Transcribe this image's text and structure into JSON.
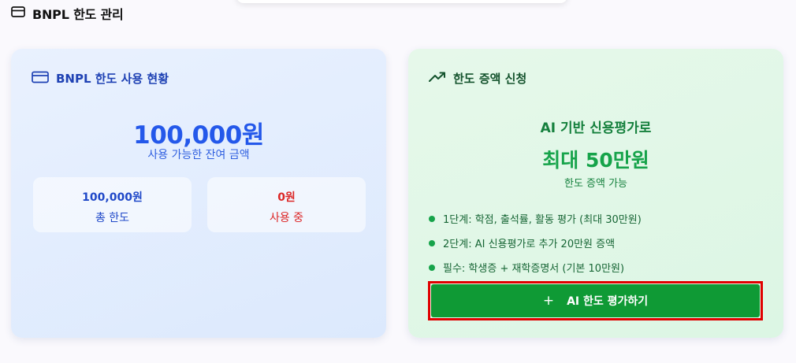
{
  "page": {
    "title": "BNPL 한도 관리"
  },
  "usage_card": {
    "title": "BNPL 한도 사용 현황",
    "balance": "100,000원",
    "balance_caption": "사용 가능한 잔여 금액",
    "total": {
      "value": "100,000원",
      "label": "총 한도"
    },
    "used": {
      "value": "0원",
      "label": "사용 중"
    }
  },
  "increase_card": {
    "title": "한도 증액 신청",
    "headline": "AI 기반 신용평가로",
    "amount": "최대 50만원",
    "caption": "한도 증액 가능",
    "steps": [
      "1단계: 학점, 출석률, 활동 평가 (최대 30만원)",
      "2단계: AI 신용평가로 추가 20만원 증액",
      "필수: 학생증 + 재학증명서 (기본 10만원)"
    ],
    "cta_label": "AI 한도 평가하기",
    "cta_icon": "plus-icon"
  },
  "colors": {
    "primary_blue": "#2458ea",
    "danger_red": "#dc2626",
    "success_green": "#16a34a",
    "cta_green": "#0f9a35",
    "highlight_outline": "#e00000"
  }
}
